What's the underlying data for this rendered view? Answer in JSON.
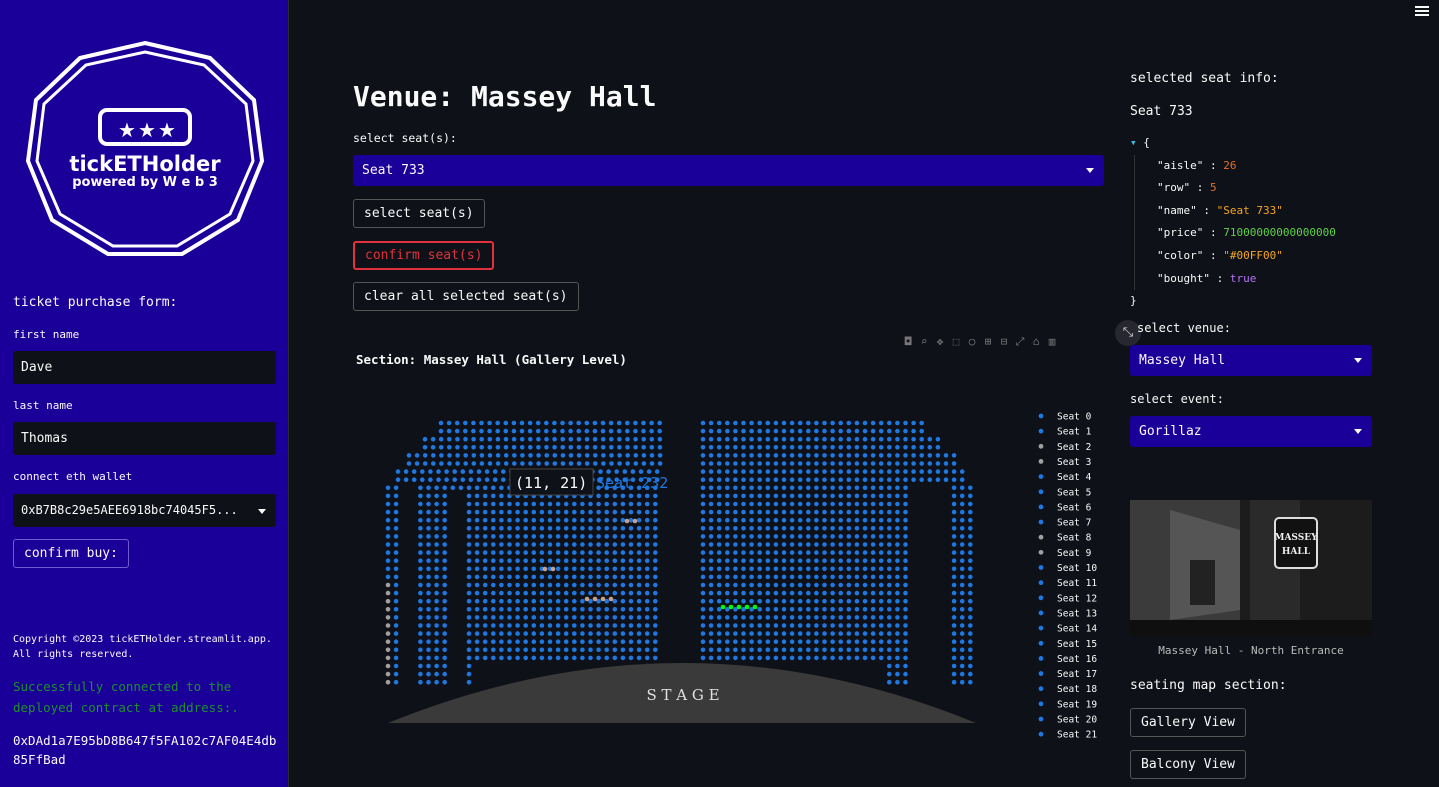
{
  "sidebar": {
    "logo": {
      "brand": "tickETHolder",
      "tagline": "powered by W e b 3"
    },
    "form_title": "ticket purchase form:",
    "first_name_label": "first name",
    "first_name_value": "Dave",
    "last_name_label": "last name",
    "last_name_value": "Thomas",
    "wallet_label": "connect eth wallet",
    "wallet_value": "0xB7B8c29e5AEE6918bc74045F5...",
    "confirm_buy_label": "confirm buy:",
    "copyright": "Copyright ©2023 tickETHolder.streamlit.app. All rights reserved.",
    "success_message": "Successfully connected to the deployed contract at address:.",
    "contract_address": "0xDAd1a7E95bD8B647f5FA102c7AF04E4db85FfBad"
  },
  "main": {
    "venue_title": "Venue: Massey Hall",
    "select_seats_label": "select seat(s):",
    "selected_seat": "Seat 733",
    "select_button": "select seat(s)",
    "confirm_button": "confirm seat(s)",
    "clear_button": "clear all selected seat(s)",
    "section_title": "Section: Massey Hall (Gallery Level)",
    "stage_label": "S T A G E",
    "hover_coord": "(11, 21)",
    "hover_seat": "Seat 232"
  },
  "right": {
    "info_title": "selected seat info:",
    "seat_name": "Seat 733",
    "seat_info": {
      "aisle": "26",
      "row": "5",
      "name": "\"Seat 733\"",
      "price": "71000000000000000",
      "color": "\"#00FF00\"",
      "bought": "true"
    },
    "venue_label": "select venue:",
    "venue_value": "Massey Hall",
    "event_label": "select event:",
    "event_value": "Gorillaz",
    "photo_caption": "Massey Hall - North Entrance",
    "photo_sign": "MASSEY HALL",
    "map_section_label": "seating map section:",
    "gallery_button": "Gallery View",
    "balcony_button": "Balcony View"
  },
  "colors": {
    "sidebar": "#1a0099",
    "available": "#1f77e0",
    "unavailable": "#a0a0a0",
    "selected": "#00ff00",
    "held": "#c8a08a"
  },
  "chart_data": {
    "type": "scatter",
    "title": "Section: Massey Hall (Gallery Level)",
    "legend": [
      "Seat 0",
      "Seat 1",
      "Seat 2",
      "Seat 3",
      "Seat 4",
      "Seat 5",
      "Seat 6",
      "Seat 7",
      "Seat 8",
      "Seat 9",
      "Seat 10",
      "Seat 11",
      "Seat 12",
      "Seat 13",
      "Seat 14",
      "Seat 15",
      "Seat 16",
      "Seat 17",
      "Seat 18",
      "Seat 19",
      "Seat 20",
      "Seat 21"
    ],
    "legend_colors": [
      "#1f77e0",
      "#1f77e0",
      "#a0a0a0",
      "#a0a0a0",
      "#1f77e0",
      "#1f77e0",
      "#1f77e0",
      "#1f77e0",
      "#a0a0a0",
      "#a0a0a0",
      "#1f77e0",
      "#1f77e0",
      "#1f77e0",
      "#1f77e0",
      "#1f77e0",
      "#1f77e0",
      "#1f77e0",
      "#1f77e0",
      "#1f77e0",
      "#1f77e0",
      "#1f77e0",
      "#1f77e0"
    ],
    "legend_placement": "right",
    "grid": false,
    "hover_point": {
      "x": 11,
      "y": 21,
      "label": "Seat 232"
    }
  }
}
